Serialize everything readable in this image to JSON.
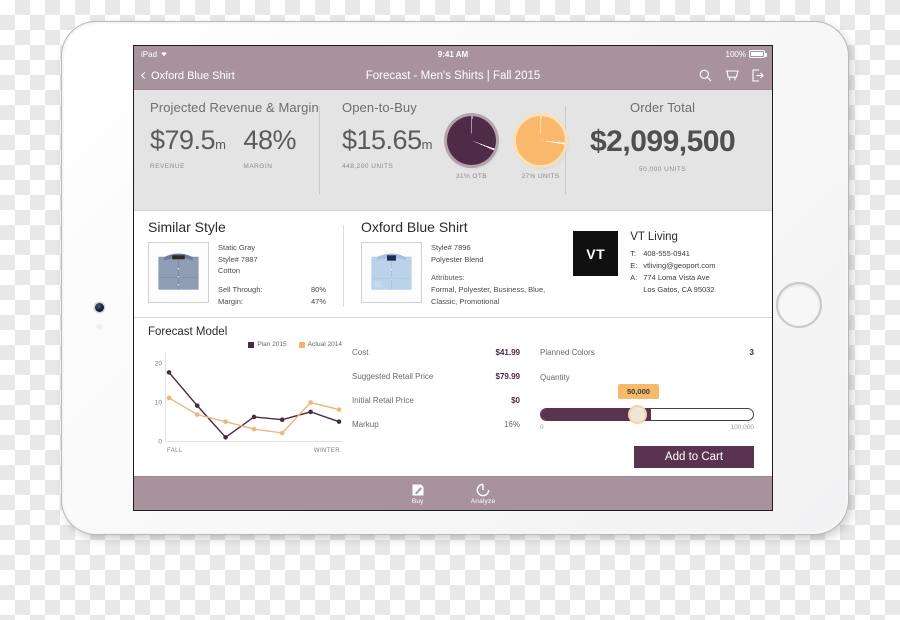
{
  "device": {
    "name": "ipad-mini"
  },
  "status_bar": {
    "carrier": "iPad",
    "wifi_icon": "wifi-icon",
    "time": "9:41 AM",
    "battery_percent": "100%",
    "battery_icon": "battery-full-icon"
  },
  "nav": {
    "back_label": "Oxford Blue Shirt",
    "back_icon": "chevron-left-icon",
    "title": "Forecast - Men's Shirts | Fall 2015",
    "actions": [
      {
        "name": "search-icon",
        "label": "Search"
      },
      {
        "name": "cart-icon",
        "label": "Cart"
      },
      {
        "name": "logout-icon",
        "label": "Log out"
      }
    ]
  },
  "kpi": {
    "projected": {
      "heading": "Projected Revenue & Margin",
      "metrics": [
        {
          "value": "$79.5",
          "suffix": "m",
          "sub": "REVENUE"
        },
        {
          "value": "48%",
          "suffix": "",
          "sub": "MARGIN"
        }
      ]
    },
    "open_to_buy": {
      "heading": "Open-to-Buy",
      "value": "$15.65",
      "suffix": "m",
      "sub": "448,200 UNITS"
    },
    "pies": [
      {
        "name": "otb-pie",
        "label": "31% OTB",
        "percent": 31,
        "color": "#4f2b47",
        "ring": "#b3a4ab"
      },
      {
        "name": "units-pie",
        "label": "27% UNITS",
        "percent": 27,
        "color": "#f8b96c",
        "ring": "#fadfb9"
      }
    ],
    "order_total": {
      "heading": "Order Total",
      "value": "$2,099,500",
      "sub": "50,000 UNITS"
    }
  },
  "similar_style": {
    "title": "Similar Style",
    "thumb_icon": "gray-dress-shirt-image",
    "name": "Static Gray",
    "style_number": "Style# 7887",
    "material": "Cotton",
    "stats": [
      {
        "label": "Sell Through:",
        "value": "80%"
      },
      {
        "label": "Margin:",
        "value": "47%"
      }
    ]
  },
  "product": {
    "title": "Oxford Blue Shirt",
    "thumb_icon": "blue-dress-shirt-image",
    "style_number": "Style# 7896",
    "material": "Polyester Blend",
    "attributes_label": "Attributes:",
    "attributes_line1": "Formal, Polyester, Business, Blue,",
    "attributes_line2": "Classic, Promotional"
  },
  "vendor": {
    "logo_text": "VT",
    "name": "VT Living",
    "contacts": [
      {
        "key": "T:",
        "value": "408-555-0941"
      },
      {
        "key": "E:",
        "value": "vtliving@geoport.com"
      },
      {
        "key": "A:",
        "value": "774 Loma Vista Ave"
      },
      {
        "key": "",
        "value": "Los Gatos, CA 95032"
      }
    ]
  },
  "forecast": {
    "title": "Forecast Model",
    "metrics": [
      {
        "label": "Cost",
        "value": "$41.99",
        "accent": true
      },
      {
        "label": "Suggested Retail Price",
        "value": "$79.99",
        "accent": true
      },
      {
        "label": "Initial Retail Price",
        "value": "$0",
        "accent": true
      },
      {
        "label": "Markup",
        "value": "16%",
        "accent": false
      }
    ],
    "planned_colors": {
      "label": "Planned Colors",
      "value": "3"
    },
    "quantity": {
      "label": "Quantity",
      "current": "50,000",
      "min": "0",
      "max": "100,000",
      "percent": 52
    },
    "add_to_cart": "Add to Cart"
  },
  "tabbar": {
    "tabs": [
      {
        "name": "tab-buy",
        "icon": "pencil-square-icon",
        "label": "Buy"
      },
      {
        "name": "tab-analyze",
        "icon": "gauge-icon",
        "label": "Analyze"
      }
    ]
  },
  "chart_data": {
    "type": "line",
    "title": "Forecast Model",
    "xlabel": "",
    "ylabel": "",
    "ylim": [
      0,
      22
    ],
    "yticks": [
      0,
      10,
      20
    ],
    "grid": false,
    "legend_position": "top-right",
    "x_tick_labels": [
      "FALL",
      "WINTER"
    ],
    "x": [
      1,
      2,
      3,
      4,
      5,
      6,
      7,
      8,
      9
    ],
    "series": [
      {
        "name": "Plan 2015",
        "color": "#4b2a44",
        "values": [
          17.8,
          9.3,
          1.2,
          6.4,
          5.7,
          7.7,
          5.2
        ]
      },
      {
        "name": "Actual 2014",
        "color": "#eeb679",
        "values": [
          11.3,
          7.0,
          5.2,
          3.3,
          2.3,
          10.1,
          8.3
        ]
      }
    ],
    "x_positions": [
      0,
      16.6,
      33.3,
      50,
      66.6,
      83.3,
      100
    ]
  }
}
